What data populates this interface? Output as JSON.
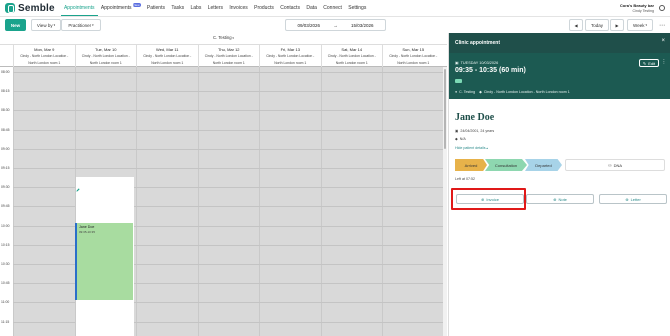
{
  "app": {
    "brand": "Semble",
    "nav": [
      {
        "label": "Appointments",
        "active": true
      },
      {
        "label": "Appointments",
        "badge": "New"
      },
      {
        "label": "Patients"
      },
      {
        "label": "Tasks"
      },
      {
        "label": "Labs"
      },
      {
        "label": "Letters"
      },
      {
        "label": "Invoices"
      },
      {
        "label": "Products"
      },
      {
        "label": "Contacts"
      },
      {
        "label": "Data"
      },
      {
        "label": "Connect"
      },
      {
        "label": "Settings"
      }
    ],
    "account": {
      "clinic": "Cora's Beauty bar",
      "user": "Cindy Testing"
    }
  },
  "toolbar": {
    "new_label": "New",
    "view_by_label": "View by",
    "practitioner_label": "Practitioner",
    "date_from": "09/03/2026",
    "date_sep": "→",
    "date_to": "15/03/2026",
    "today_label": "Today",
    "week_label": "Week",
    "prev_icon": "chevron-left-icon",
    "next_icon": "chevron-right-icon"
  },
  "calendar": {
    "practitioner": "C. Testing",
    "days": [
      {
        "name": "Mon, Mar 9",
        "loc1": "Cindy - North London Location -",
        "loc2": "North London room 1"
      },
      {
        "name": "Tue, Mar 10",
        "loc1": "Cindy - North London Location -",
        "loc2": "North London room 1"
      },
      {
        "name": "Wed, Mar 11",
        "loc1": "Cindy - North London Location -",
        "loc2": "North London room 1"
      },
      {
        "name": "Thu, Mar 12",
        "loc1": "Cindy - North London Location -",
        "loc2": "North London room 1"
      },
      {
        "name": "Fri, Mar 13",
        "loc1": "Cindy - North London Location -",
        "loc2": "North London room 1"
      },
      {
        "name": "Sat, Mar 14",
        "loc1": "Cindy - North London Location -",
        "loc2": "North London room 1"
      },
      {
        "name": "Sun, Mar 15",
        "loc1": "Cindy - North London Location -",
        "loc2": "North London room 1"
      }
    ],
    "times": [
      "08:00",
      "08:15",
      "08:30",
      "08:45",
      "09:00",
      "09:15",
      "09:30",
      "09:45",
      "10:00",
      "10:15",
      "10:30",
      "10:45",
      "11:00",
      "11:15"
    ],
    "appointment": {
      "patient": "Jane Doe",
      "time": "09:35-10:35",
      "color": "#a8dca0"
    }
  },
  "panel": {
    "title": "Clinic appointment",
    "date_line": "TUESDAY 10/03/2026",
    "time_range": "09:35 - 10:35",
    "duration": "(60 min)",
    "edit_label": "Edit",
    "practitioner": "C. Testing",
    "location": "Cindy - North London Location - North London room 1",
    "patient_name": "Jane Doe",
    "dob": "24/04/2001, 24 years",
    "address": "N/A",
    "hide_details": "Hide patient details",
    "stages": [
      "Arrived",
      "Consultation",
      "Departed"
    ],
    "dna_label": "DNA",
    "left_at": "Left at 07:52",
    "actions": {
      "invoice": "Invoice",
      "note": "Note",
      "letter": "Letter"
    }
  },
  "colors": {
    "accent": "#1aa38c",
    "header": "#1f4f4a",
    "appointment_block": "#1c5a52",
    "highlight": "#e01919"
  }
}
